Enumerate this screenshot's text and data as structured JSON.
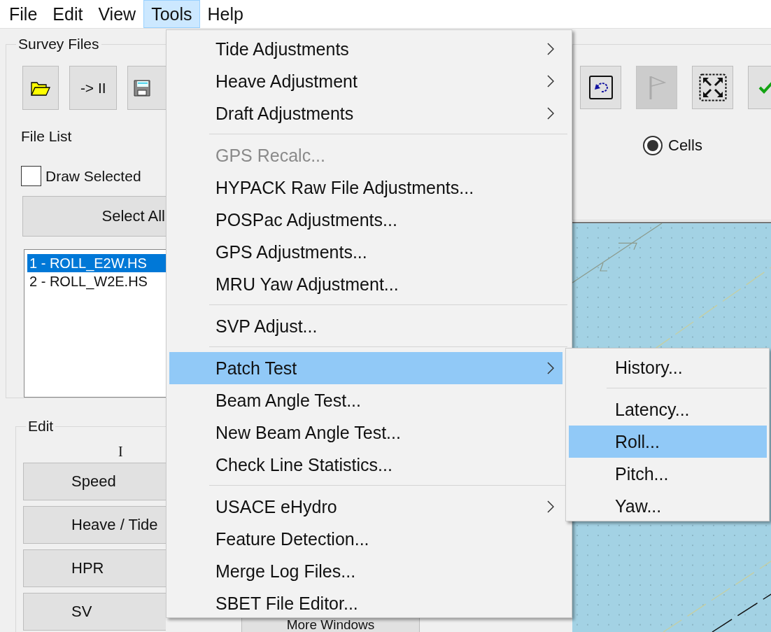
{
  "menubar": [
    {
      "label": "File",
      "selected": false
    },
    {
      "label": "Edit",
      "selected": false
    },
    {
      "label": "View",
      "selected": false
    },
    {
      "label": "Tools",
      "selected": true
    },
    {
      "label": "Help",
      "selected": false
    }
  ],
  "survey_files": {
    "title": "Survey Files",
    "skip_button_label": "-> II",
    "file_list_label": "File List",
    "draw_selected": {
      "label": "Draw Selected",
      "checked": false
    },
    "select_all_label": "Select All",
    "files": [
      {
        "name": "1 - ROLL_E2W.HS",
        "selected": true
      },
      {
        "name": "2 - ROLL_W2E.HS",
        "selected": false
      }
    ]
  },
  "edit": {
    "title": "Edit",
    "column_label": "I",
    "buttons": [
      "Speed",
      "Heave / Tide",
      "HPR",
      "SV"
    ]
  },
  "more_windows_label": "More Windows",
  "display_toolbar": {
    "flag_disabled": true,
    "cells": {
      "label": "Cells",
      "selected": true
    }
  },
  "tools_menu": {
    "items": [
      {
        "kind": "item",
        "label": "Tide Adjustments",
        "has_submenu": true,
        "disabled": false,
        "selected": false
      },
      {
        "kind": "item",
        "label": "Heave Adjustment",
        "has_submenu": true,
        "disabled": false,
        "selected": false
      },
      {
        "kind": "item",
        "label": "Draft Adjustments",
        "has_submenu": true,
        "disabled": false,
        "selected": false
      },
      {
        "kind": "separator"
      },
      {
        "kind": "item",
        "label": "GPS Recalc...",
        "has_submenu": false,
        "disabled": true,
        "selected": false
      },
      {
        "kind": "item",
        "label": "HYPACK Raw File Adjustments...",
        "has_submenu": false,
        "disabled": false,
        "selected": false
      },
      {
        "kind": "item",
        "label": "POSPac Adjustments...",
        "has_submenu": false,
        "disabled": false,
        "selected": false
      },
      {
        "kind": "item",
        "label": "GPS Adjustments...",
        "has_submenu": false,
        "disabled": false,
        "selected": false
      },
      {
        "kind": "item",
        "label": "MRU Yaw Adjustment...",
        "has_submenu": false,
        "disabled": false,
        "selected": false
      },
      {
        "kind": "separator"
      },
      {
        "kind": "item",
        "label": "SVP Adjust...",
        "has_submenu": false,
        "disabled": false,
        "selected": false
      },
      {
        "kind": "separator"
      },
      {
        "kind": "item",
        "label": "Patch Test",
        "has_submenu": true,
        "disabled": false,
        "selected": true
      },
      {
        "kind": "item",
        "label": "Beam Angle Test...",
        "has_submenu": false,
        "disabled": false,
        "selected": false
      },
      {
        "kind": "item",
        "label": "New Beam Angle Test...",
        "has_submenu": false,
        "disabled": false,
        "selected": false
      },
      {
        "kind": "item",
        "label": "Check Line Statistics...",
        "has_submenu": false,
        "disabled": false,
        "selected": false
      },
      {
        "kind": "separator"
      },
      {
        "kind": "item",
        "label": "USACE eHydro",
        "has_submenu": true,
        "disabled": false,
        "selected": false
      },
      {
        "kind": "item",
        "label": "Feature Detection...",
        "has_submenu": false,
        "disabled": false,
        "selected": false
      },
      {
        "kind": "item",
        "label": "Merge Log Files...",
        "has_submenu": false,
        "disabled": false,
        "selected": false
      },
      {
        "kind": "item",
        "label": "SBET File Editor...",
        "has_submenu": false,
        "disabled": false,
        "selected": false
      }
    ]
  },
  "patch_test_submenu": {
    "items": [
      {
        "kind": "item",
        "label": "History...",
        "selected": false
      },
      {
        "kind": "separator"
      },
      {
        "kind": "item",
        "label": "Latency...",
        "selected": false
      },
      {
        "kind": "item",
        "label": "Roll...",
        "selected": true
      },
      {
        "kind": "item",
        "label": "Pitch...",
        "selected": false
      },
      {
        "kind": "item",
        "label": "Yaw...",
        "selected": false
      }
    ]
  }
}
